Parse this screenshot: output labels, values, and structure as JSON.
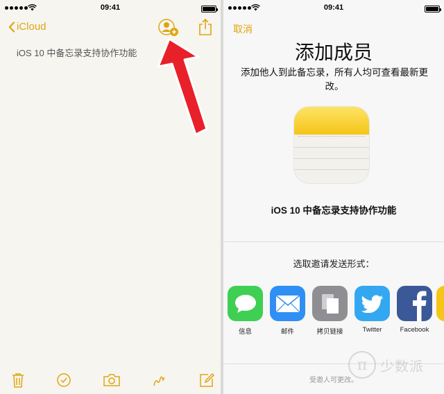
{
  "status_bar": {
    "time": "09:41"
  },
  "left": {
    "back_label": "iCloud",
    "note_text": "iOS 10 中备忘录支持协作功能",
    "toolbar_icons": [
      "trash-icon",
      "checklist-icon",
      "camera-icon",
      "sketch-icon",
      "compose-icon"
    ],
    "accent_color": "#e0a50e",
    "annotation_color": "#e8202a"
  },
  "right": {
    "cancel_label": "取消",
    "title": "添加成员",
    "description": "添加他人到此备忘录，所有人均可查看最新更改。",
    "note_name": "iOS 10 中备忘录支持协作功能",
    "invite_label": "选取邀请发送形式：",
    "apps": [
      {
        "label": "信息",
        "icon": "messages-icon",
        "color": "#3fcf52"
      },
      {
        "label": "邮件",
        "icon": "mail-icon",
        "color": "#2f8ff4"
      },
      {
        "label": "拷贝链接",
        "icon": "copy-link-icon",
        "color": "#8e8e93"
      },
      {
        "label": "Twitter",
        "icon": "twitter-icon",
        "color": "#33a8f0"
      },
      {
        "label": "Facebook",
        "icon": "facebook-icon",
        "color": "#3b5998"
      }
    ],
    "footer": "受邀人可更改。"
  },
  "watermark": {
    "glyph": "π",
    "text": "少数派"
  }
}
